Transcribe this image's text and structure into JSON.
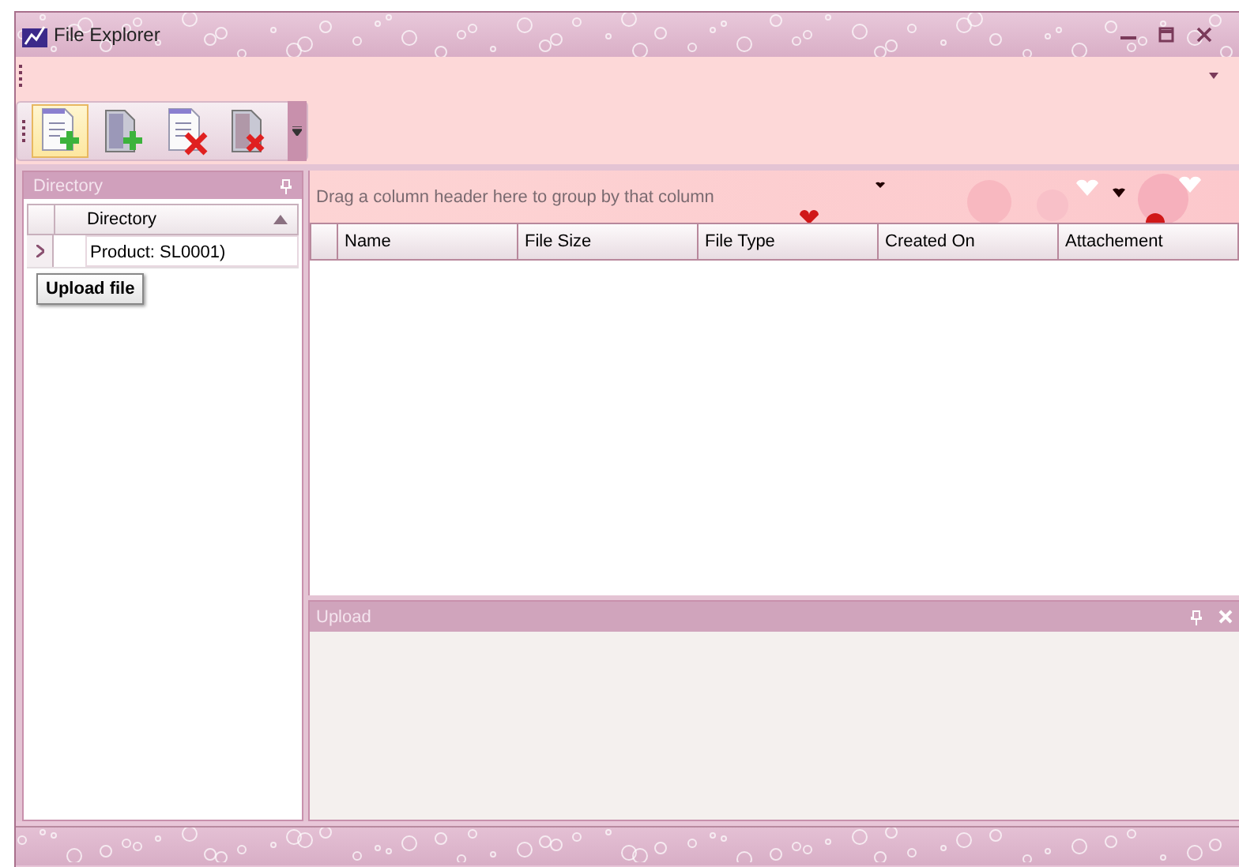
{
  "window": {
    "title": "File Explorer"
  },
  "toolbar": {
    "buttons": [
      {
        "kind": "doc-add",
        "highlighted": true
      },
      {
        "kind": "file-add",
        "highlighted": false
      },
      {
        "kind": "doc-remove",
        "highlighted": false
      },
      {
        "kind": "file-remove",
        "highlighted": false
      }
    ]
  },
  "tooltip": "Upload file",
  "directory_panel": {
    "title": "Directory",
    "column": "Directory",
    "rows": [
      {
        "label": "Product: SL0001)",
        "selected": true
      }
    ]
  },
  "grid": {
    "group_hint": "Drag a column header here to group by that column",
    "columns": [
      "Name",
      "File Size",
      "File Type",
      "Created On",
      "Attachement"
    ]
  },
  "upload_panel": {
    "title": "Upload"
  }
}
